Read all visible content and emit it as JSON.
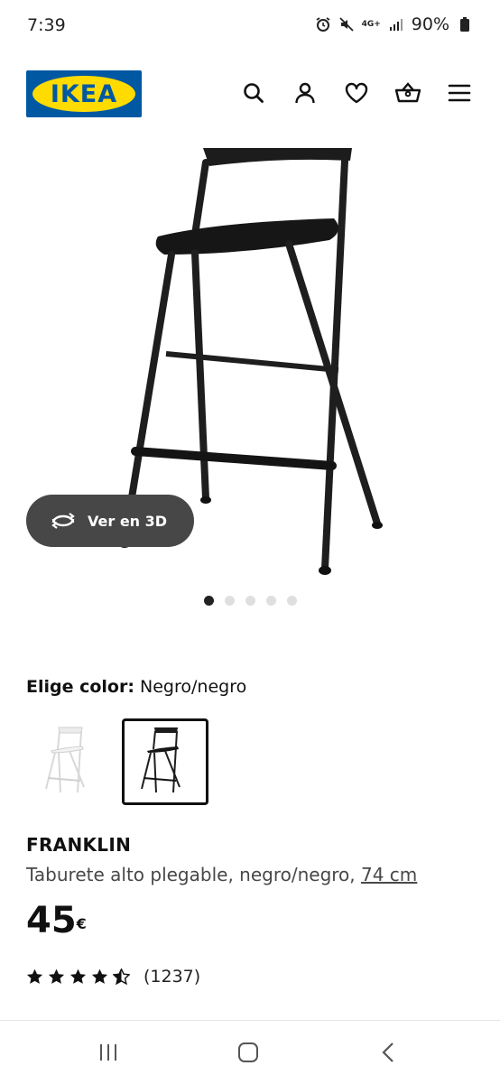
{
  "status_bar": {
    "time": "7:39",
    "network": "4G+",
    "battery": "90%",
    "icons": [
      "alarm-icon",
      "mute-icon",
      "network-4g-icon",
      "signal-icon",
      "battery-icon"
    ]
  },
  "header": {
    "logo_text": "IKEA",
    "brand_colors": {
      "blue": "#0058a3",
      "yellow": "#ffdb00"
    },
    "icons": [
      "search-icon",
      "account-icon",
      "wishlist-heart-icon",
      "cart-basket-icon",
      "menu-icon"
    ]
  },
  "gallery": {
    "view_3d_label": "Ver en 3D",
    "image_count": 5,
    "active_index": 0
  },
  "color_picker": {
    "label": "Elige color:",
    "selected": "Negro/negro",
    "options": [
      {
        "name": "blanco",
        "color": "#f2f2f2",
        "selected": false
      },
      {
        "name": "negro",
        "color": "#1a1a1a",
        "selected": true
      }
    ]
  },
  "product": {
    "name": "FRANKLIN",
    "description": "Taburete alto plegable, negro/negro,",
    "size": "74 cm",
    "price": "45",
    "currency": "€"
  },
  "rating": {
    "stars": 4.5,
    "count": "(1237)"
  },
  "system_nav": {
    "icons": [
      "recent-apps-icon",
      "home-icon",
      "back-icon"
    ]
  }
}
